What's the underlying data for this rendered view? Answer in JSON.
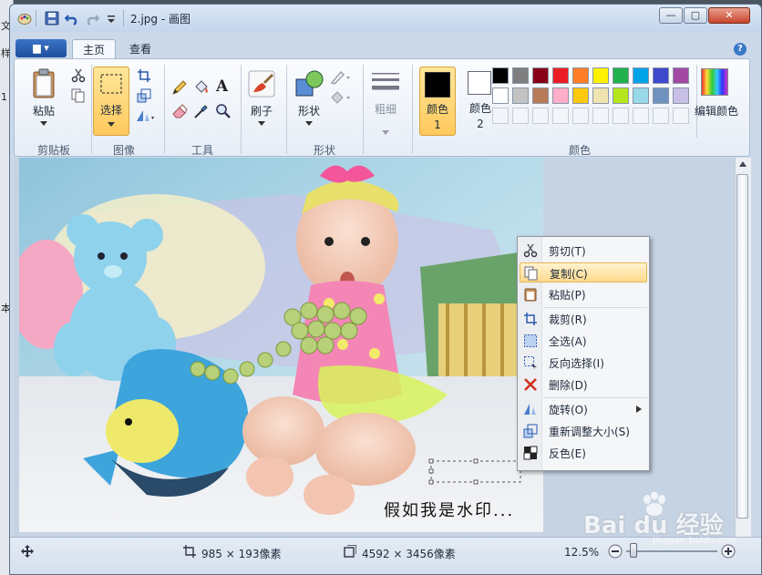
{
  "left_strip": {
    "chars": [
      "文",
      "样",
      "1",
      "本"
    ]
  },
  "titlebar": {
    "title": "2.jpg - 画图",
    "min": "—",
    "max": "▢",
    "close": "✕"
  },
  "tabs": [
    {
      "label": "主页",
      "active": true
    },
    {
      "label": "查看",
      "active": false
    }
  ],
  "file_button": {
    "label": "▆ ▾"
  },
  "help_icon": "?",
  "ribbon": {
    "clipboard": {
      "label": "剪贴板",
      "paste": "粘贴"
    },
    "image": {
      "label": "图像",
      "select": "选择"
    },
    "tools": {
      "label": "工具"
    },
    "brush": {
      "label": "刷子"
    },
    "shapes": {
      "label": "形状",
      "shapes_btn": "形状"
    },
    "size": {
      "label": "粗细"
    },
    "colors": {
      "label": "颜色",
      "color1": "颜色 1",
      "color2": "颜色 2",
      "edit": "编辑颜色",
      "color1_value": "#000000",
      "color2_value": "#ffffff",
      "palette_row1": [
        "#000000",
        "#7f7f7f",
        "#880015",
        "#ed1c24",
        "#ff7f27",
        "#fff200",
        "#22b14c",
        "#00a2e8",
        "#3f48cc",
        "#a349a4"
      ],
      "palette_row2": [
        "#ffffff",
        "#c3c3c3",
        "#b97a57",
        "#ffaec9",
        "#ffc90e",
        "#efe4b0",
        "#b5e61d",
        "#99d9ea",
        "#7092be",
        "#c8bfe7"
      ]
    }
  },
  "context_menu": [
    {
      "label": "剪切(T)",
      "icon": "scissors-icon"
    },
    {
      "label": "复制(C)",
      "icon": "copy-icon",
      "highlighted": true
    },
    {
      "label": "粘贴(P)",
      "icon": "paste-icon"
    },
    {
      "label": "裁剪(R)",
      "icon": "crop-icon"
    },
    {
      "label": "全选(A)",
      "icon": "select-all-icon"
    },
    {
      "label": "反向选择(I)",
      "icon": "invert-selection-icon"
    },
    {
      "label": "删除(D)",
      "icon": "delete-icon"
    },
    {
      "label": "旋转(O)",
      "icon": "rotate-icon",
      "submenu": true
    },
    {
      "label": "重新调整大小(S)",
      "icon": "resize-icon"
    },
    {
      "label": "反色(E)",
      "icon": "invert-color-icon"
    }
  ],
  "canvas": {
    "watermark_text": "假如我是水印..."
  },
  "status": {
    "selection_size": "985 × 193像素",
    "image_size": "4592 × 3456像素",
    "zoom": "12.5%"
  },
  "branding": {
    "baidu": "Bai du 经验",
    "url": "jingyan.baidu.com"
  }
}
